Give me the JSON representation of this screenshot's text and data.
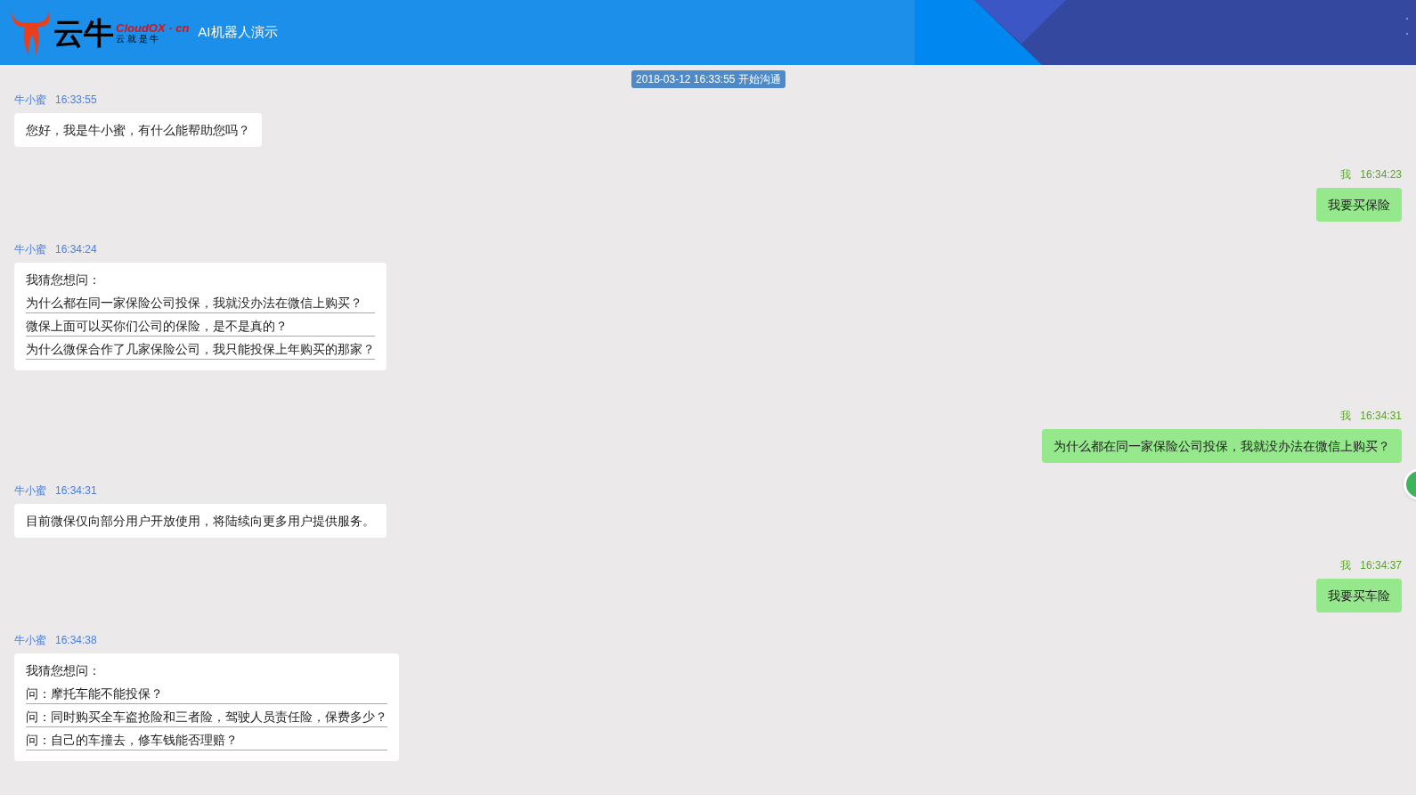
{
  "header": {
    "logo": {
      "mark": "云牛",
      "brand": "CloudOX · cn",
      "slogan": "云 就 是 牛"
    },
    "title": "AI机器人演示"
  },
  "session_start": "2018-03-12 16:33:55 开始沟通",
  "messages": [
    {
      "kind": "bot",
      "sender": "牛小蜜",
      "time": "16:33:55",
      "text": "您好，我是牛小蜜，有什么能帮助您吗？"
    },
    {
      "kind": "user",
      "sender": "我",
      "time": "16:34:23",
      "text": "我要买保险"
    },
    {
      "kind": "suggestions",
      "sender": "牛小蜜",
      "time": "16:34:24",
      "text": "我猜您想问：",
      "questions": [
        "为什么都在同一家保险公司投保，我就没办法在微信上购买？",
        "微保上面可以买你们公司的保险，是不是真的？",
        "为什么微保合作了几家保险公司，我只能投保上年购买的那家？"
      ]
    },
    {
      "kind": "user",
      "sender": "我",
      "time": "16:34:31",
      "text": "为什么都在同一家保险公司投保，我就没办法在微信上购买？"
    },
    {
      "kind": "bot",
      "sender": "牛小蜜",
      "time": "16:34:31",
      "text": "目前微保仅向部分用户开放使用，将陆续向更多用户提供服务。"
    },
    {
      "kind": "user",
      "sender": "我",
      "time": "16:34:37",
      "text": "我要买车险"
    },
    {
      "kind": "suggestions",
      "sender": "牛小蜜",
      "time": "16:34:38",
      "text": "我猜您想问：",
      "questions": [
        "问：摩托车能不能投保？",
        "问：同时购买全车盗抢险和三者险，驾驶人员责任险，保费多少？",
        "问：自己的车撞去，修车钱能否理赔？"
      ]
    }
  ]
}
